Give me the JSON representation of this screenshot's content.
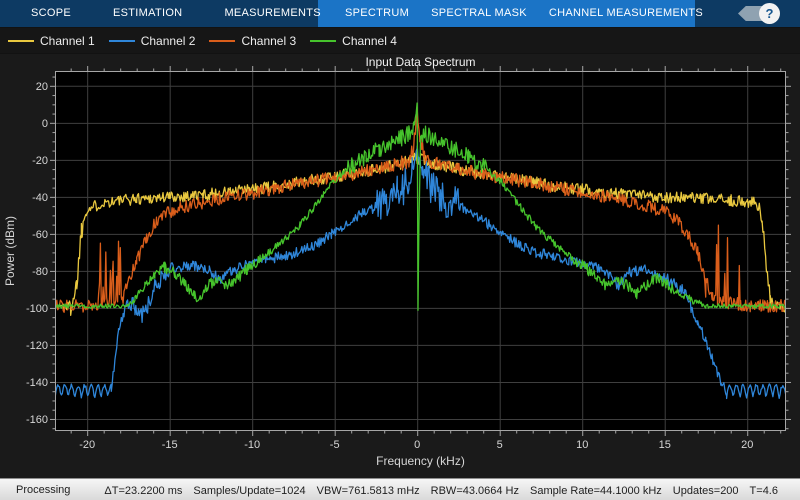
{
  "toolbar": {
    "left_tabs": [
      "SCOPE",
      "ESTIMATION",
      "MEASUREMENTS"
    ],
    "right_tabs": [
      "SPECTRUM",
      "SPECTRAL MASK",
      "CHANNEL MEASUREMENTS"
    ],
    "help_label": "?",
    "dark_bg": "#0D3A63",
    "light_bg": "#1B74C6"
  },
  "legend": {
    "items": [
      "Channel 1",
      "Channel 2",
      "Channel 3",
      "Channel 4"
    ]
  },
  "chart_data": {
    "type": "line",
    "title": "Input Data Spectrum",
    "xlabel": "Frequency (kHz)",
    "ylabel": "Power (dBm)",
    "xlim": [
      -21.95,
      22.35
    ],
    "ylim": [
      -166.5,
      28
    ],
    "x_ticks": [
      -20,
      -15,
      -10,
      -5,
      0,
      5,
      10,
      15,
      20
    ],
    "y_ticks": [
      20,
      0,
      -20,
      -40,
      -60,
      -80,
      -100,
      -120,
      -140,
      -160
    ],
    "x_minor_step": 1,
    "y_minor_step": 5,
    "grid": true,
    "plot_bg": "#000000",
    "grid_color": "#3F3F3F",
    "axis_color": "#A6A6A6",
    "label_color": "#D6D6D6",
    "series": [
      {
        "name": "Channel 1",
        "color": "#E9C83F",
        "noise_default": 3.2,
        "noise_zones": [
          {
            "from": -21.0,
            "to": -20.2,
            "amp": 6
          },
          {
            "from": 20.7,
            "to": 21.4,
            "amp": 5
          }
        ],
        "envelope": [
          [
            -21.95,
            -99
          ],
          [
            -21.0,
            -99
          ],
          [
            -20.65,
            -88
          ],
          [
            -20.35,
            -58
          ],
          [
            -20.05,
            -47
          ],
          [
            -19.0,
            -43
          ],
          [
            -17.0,
            -41
          ],
          [
            -15.0,
            -40
          ],
          [
            -13.0,
            -39
          ],
          [
            -11.0,
            -37
          ],
          [
            -9.0,
            -35
          ],
          [
            -7.0,
            -32
          ],
          [
            -5.0,
            -29
          ],
          [
            -3.5,
            -27
          ],
          [
            -2.0,
            -24
          ],
          [
            -1.0,
            -22
          ],
          [
            -0.4,
            -20
          ],
          [
            0,
            -19
          ],
          [
            0.4,
            -20
          ],
          [
            1.0,
            -22
          ],
          [
            2.0,
            -24
          ],
          [
            3.5,
            -27
          ],
          [
            5.0,
            -29
          ],
          [
            7.0,
            -32
          ],
          [
            9.0,
            -35
          ],
          [
            11.0,
            -37
          ],
          [
            13.0,
            -39
          ],
          [
            15.0,
            -40
          ],
          [
            17.0,
            -41
          ],
          [
            19.0,
            -42
          ],
          [
            20.5,
            -43
          ],
          [
            20.9,
            -52
          ],
          [
            21.15,
            -78
          ],
          [
            21.4,
            -97
          ],
          [
            21.7,
            -99
          ],
          [
            22.35,
            -99
          ]
        ]
      },
      {
        "name": "Channel 2",
        "color": "#2F86D9",
        "noise_default": 2.8,
        "noise_zones": [
          {
            "from": -17.9,
            "to": -14.8,
            "amp": 4.5
          },
          {
            "from": 14.8,
            "to": 16.6,
            "amp": 3.5
          },
          {
            "from": -2.5,
            "to": -0.3,
            "amp": 10
          },
          {
            "from": 0.3,
            "to": 2.5,
            "amp": 10
          }
        ],
        "ripple_zones": [
          {
            "from": -21.95,
            "to": -18.55,
            "base": -148.5,
            "amp": 6.5,
            "period": 0.4
          },
          {
            "from": 18.75,
            "to": 22.35,
            "base": -148.5,
            "amp": 6.5,
            "period": 0.4
          }
        ],
        "envelope": [
          [
            -18.55,
            -145
          ],
          [
            -18.3,
            -128
          ],
          [
            -18.1,
            -114
          ],
          [
            -17.85,
            -102
          ],
          [
            -17.5,
            -96
          ],
          [
            -17.1,
            -100
          ],
          [
            -16.7,
            -105
          ],
          [
            -16.3,
            -98
          ],
          [
            -15.9,
            -89
          ],
          [
            -15.3,
            -81
          ],
          [
            -14.6,
            -78
          ],
          [
            -13.6,
            -77
          ],
          [
            -12.6,
            -80
          ],
          [
            -11.9,
            -85
          ],
          [
            -11.3,
            -80
          ],
          [
            -10.2,
            -76
          ],
          [
            -9.2,
            -74
          ],
          [
            -8.2,
            -72
          ],
          [
            -7.2,
            -70
          ],
          [
            -6.2,
            -66
          ],
          [
            -5.2,
            -60
          ],
          [
            -4.2,
            -54
          ],
          [
            -3.2,
            -48
          ],
          [
            -2.4,
            -45
          ],
          [
            -1.7,
            -41
          ],
          [
            -1.2,
            -38
          ],
          [
            -0.8,
            -34
          ],
          [
            -0.5,
            -30
          ],
          [
            -0.3,
            -25
          ],
          [
            -0.15,
            -20
          ],
          [
            0,
            -14
          ],
          [
            0.15,
            -20
          ],
          [
            0.3,
            -25
          ],
          [
            0.5,
            -30
          ],
          [
            0.8,
            -34
          ],
          [
            1.2,
            -38
          ],
          [
            1.7,
            -41
          ],
          [
            2.4,
            -45
          ],
          [
            3.2,
            -48
          ],
          [
            4.2,
            -54
          ],
          [
            5.2,
            -60
          ],
          [
            6.2,
            -66
          ],
          [
            7.2,
            -70
          ],
          [
            8.2,
            -72
          ],
          [
            9.2,
            -74
          ],
          [
            10.2,
            -76
          ],
          [
            11.2,
            -79
          ],
          [
            12.2,
            -88
          ],
          [
            12.8,
            -81
          ],
          [
            13.6,
            -79
          ],
          [
            14.4,
            -81
          ],
          [
            15.1,
            -84
          ],
          [
            15.7,
            -87
          ],
          [
            16.2,
            -92
          ],
          [
            16.6,
            -99
          ],
          [
            17.0,
            -108
          ],
          [
            17.5,
            -118
          ],
          [
            18.0,
            -130
          ],
          [
            18.4,
            -140
          ],
          [
            18.75,
            -146
          ]
        ]
      },
      {
        "name": "Channel 3",
        "color": "#DA5E1B",
        "noise_default": 3.5,
        "noise_zones": [
          {
            "from": -1.0,
            "to": 1.0,
            "amp": 4.5
          }
        ],
        "spike_zones": [
          {
            "from": -19.35,
            "to": -17.7,
            "base": -98,
            "max": -58,
            "prob": 0.3
          },
          {
            "from": 17.3,
            "to": 19.55,
            "base": -98,
            "max": -48,
            "prob": 0.32
          }
        ],
        "envelope": [
          [
            -21.95,
            -99
          ],
          [
            -19.4,
            -99
          ],
          [
            -17.9,
            -96
          ],
          [
            -17.5,
            -86
          ],
          [
            -17.0,
            -75
          ],
          [
            -16.4,
            -62
          ],
          [
            -15.8,
            -53
          ],
          [
            -15.0,
            -48
          ],
          [
            -14.0,
            -45
          ],
          [
            -12.0,
            -41
          ],
          [
            -10.0,
            -38
          ],
          [
            -8.0,
            -34
          ],
          [
            -6.0,
            -31
          ],
          [
            -4.0,
            -28
          ],
          [
            -2.5,
            -25
          ],
          [
            -1.2,
            -22
          ],
          [
            -0.5,
            -20
          ],
          [
            -0.15,
            -9
          ],
          [
            0,
            5
          ],
          [
            0.15,
            -9
          ],
          [
            0.5,
            -20
          ],
          [
            1.2,
            -22
          ],
          [
            2.5,
            -25
          ],
          [
            4.0,
            -28
          ],
          [
            6.0,
            -31
          ],
          [
            8.0,
            -34
          ],
          [
            10.0,
            -38
          ],
          [
            12.0,
            -41
          ],
          [
            14.0,
            -45
          ],
          [
            15.0,
            -48
          ],
          [
            15.8,
            -53
          ],
          [
            16.4,
            -60
          ],
          [
            17.0,
            -70
          ],
          [
            17.5,
            -85
          ],
          [
            17.9,
            -95
          ],
          [
            19.6,
            -99
          ],
          [
            22.35,
            -99
          ]
        ]
      },
      {
        "name": "Channel 4",
        "color": "#46C32C",
        "noise_default": 2,
        "noise_zones": [
          {
            "from": -21.95,
            "to": -17.4,
            "amp": 1.2
          },
          {
            "from": 17.2,
            "to": 22.35,
            "amp": 1.2
          },
          {
            "from": -4.2,
            "to": -0.25,
            "amp": 4.5
          },
          {
            "from": 0.25,
            "to": 4.2,
            "amp": 4.5
          },
          {
            "from": -15.6,
            "to": -9.5,
            "amp": 3
          },
          {
            "from": 9.5,
            "to": 15.6,
            "amp": 3
          }
        ],
        "envelope": [
          [
            -21.95,
            -99
          ],
          [
            -17.6,
            -99
          ],
          [
            -17.1,
            -95
          ],
          [
            -16.5,
            -88
          ],
          [
            -15.9,
            -82
          ],
          [
            -15.3,
            -78
          ],
          [
            -14.7,
            -81
          ],
          [
            -14.1,
            -87
          ],
          [
            -13.5,
            -94
          ],
          [
            -13.1,
            -95
          ],
          [
            -12.7,
            -88
          ],
          [
            -12.1,
            -84
          ],
          [
            -11.5,
            -88
          ],
          [
            -10.9,
            -84
          ],
          [
            -10.3,
            -79
          ],
          [
            -9.5,
            -74
          ],
          [
            -8.7,
            -68
          ],
          [
            -7.9,
            -62
          ],
          [
            -7.1,
            -55
          ],
          [
            -6.3,
            -46
          ],
          [
            -5.7,
            -39
          ],
          [
            -5.1,
            -32
          ],
          [
            -4.5,
            -27
          ],
          [
            -3.9,
            -23
          ],
          [
            -3.1,
            -18
          ],
          [
            -2.3,
            -14
          ],
          [
            -1.5,
            -10
          ],
          [
            -0.9,
            -8
          ],
          [
            -0.45,
            -5
          ],
          [
            -0.18,
            -1
          ],
          [
            0,
            9
          ],
          [
            0.05,
            -101
          ],
          [
            0.1,
            -60
          ],
          [
            0.2,
            -7
          ],
          [
            0.5,
            -6
          ],
          [
            0.9,
            -8
          ],
          [
            1.5,
            -10
          ],
          [
            2.3,
            -14
          ],
          [
            3.1,
            -18
          ],
          [
            3.9,
            -23
          ],
          [
            4.5,
            -27
          ],
          [
            5.1,
            -32
          ],
          [
            5.7,
            -39
          ],
          [
            6.3,
            -46
          ],
          [
            7.1,
            -55
          ],
          [
            7.9,
            -62
          ],
          [
            8.7,
            -68
          ],
          [
            9.5,
            -74
          ],
          [
            10.3,
            -79
          ],
          [
            10.9,
            -84
          ],
          [
            11.5,
            -88
          ],
          [
            12.1,
            -84
          ],
          [
            12.7,
            -88
          ],
          [
            13.3,
            -92
          ],
          [
            13.9,
            -88
          ],
          [
            14.5,
            -84
          ],
          [
            15.1,
            -87
          ],
          [
            15.7,
            -91
          ],
          [
            16.3,
            -94
          ],
          [
            16.9,
            -97
          ],
          [
            17.5,
            -99
          ],
          [
            22.35,
            -99
          ]
        ]
      }
    ]
  },
  "status_bar": {
    "mode": "Processing",
    "items": [
      "ΔT=23.2200 ms",
      "Samples/Update=1024",
      "VBW=761.5813 mHz",
      "RBW=43.0664 Hz",
      "Sample Rate=44.1000 kHz",
      "Updates=200",
      "T=4.6"
    ]
  }
}
